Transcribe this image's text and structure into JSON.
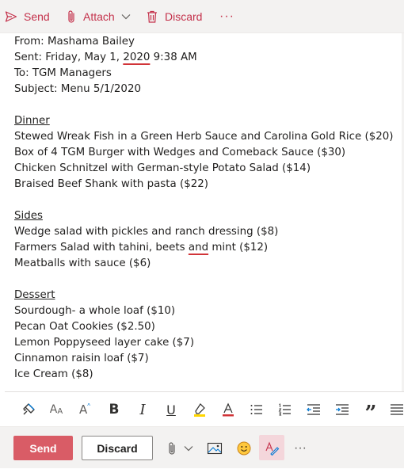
{
  "topbar": {
    "send_label": "Send",
    "attach_label": "Attach",
    "discard_label": "Discard",
    "more_label": "···"
  },
  "message": {
    "from": "From: Mashama Bailey",
    "sent_prefix": "Sent: Friday, May 1, ",
    "sent_year": "2020",
    "sent_suffix": " 9:38 AM",
    "to": "To: TGM Managers",
    "subject": "Subject: Menu 5/1/2020",
    "sections": [
      {
        "heading": "Dinner",
        "items": [
          "Stewed Wreak Fish in a Green Herb Sauce and Carolina Gold Rice ($20)",
          "Box of 4 TGM Burger with Wedges and Comeback Sauce ($30)",
          "Chicken Schnitzel with German-style Potato Salad ($14)",
          "Braised Beef Shank with pasta ($22)"
        ]
      },
      {
        "heading": "Sides",
        "items": [
          "Wedge salad with pickles and ranch dressing ($8)",
          "Farmers Salad with tahini, beets and mint ($12)",
          "Meatballs with sauce ($6)"
        ]
      },
      {
        "heading": "Dessert",
        "items": [
          "Sourdough- a whole loaf ($10)",
          "Pecan Oat Cookies ($2.50)",
          "Lemon Poppyseed layer cake ($7)",
          "Cinnamon raisin loaf ($7)",
          "Ice Cream ($8)"
        ]
      }
    ],
    "farmers_prefix": "Farmers Salad with tahini, beets ",
    "farmers_flag": "and",
    "farmers_suffix": " mint ($12)"
  },
  "formatting": {
    "italic_glyph": "I",
    "bold_glyph": "B",
    "underline_glyph": "U",
    "quote_glyph": "”",
    "font_glyph": "A",
    "text_size_glyph": "A",
    "grow_glyph": "A"
  },
  "actions": {
    "send_label": "Send",
    "discard_label": "Discard",
    "more_label": "···"
  },
  "colors": {
    "accent": "#c4314b",
    "send_button": "#d95c66",
    "toolbar_bg": "#f3f2f1",
    "active_bg": "#f4d6db"
  },
  "icons": {
    "send": "send-icon",
    "attach": "paperclip-icon",
    "discard": "trash-icon",
    "format_painter": "format-painter-icon",
    "highlight": "highlighter-icon",
    "emoji": "emoji-icon",
    "image": "image-icon",
    "editor": "editor-pen-icon"
  }
}
